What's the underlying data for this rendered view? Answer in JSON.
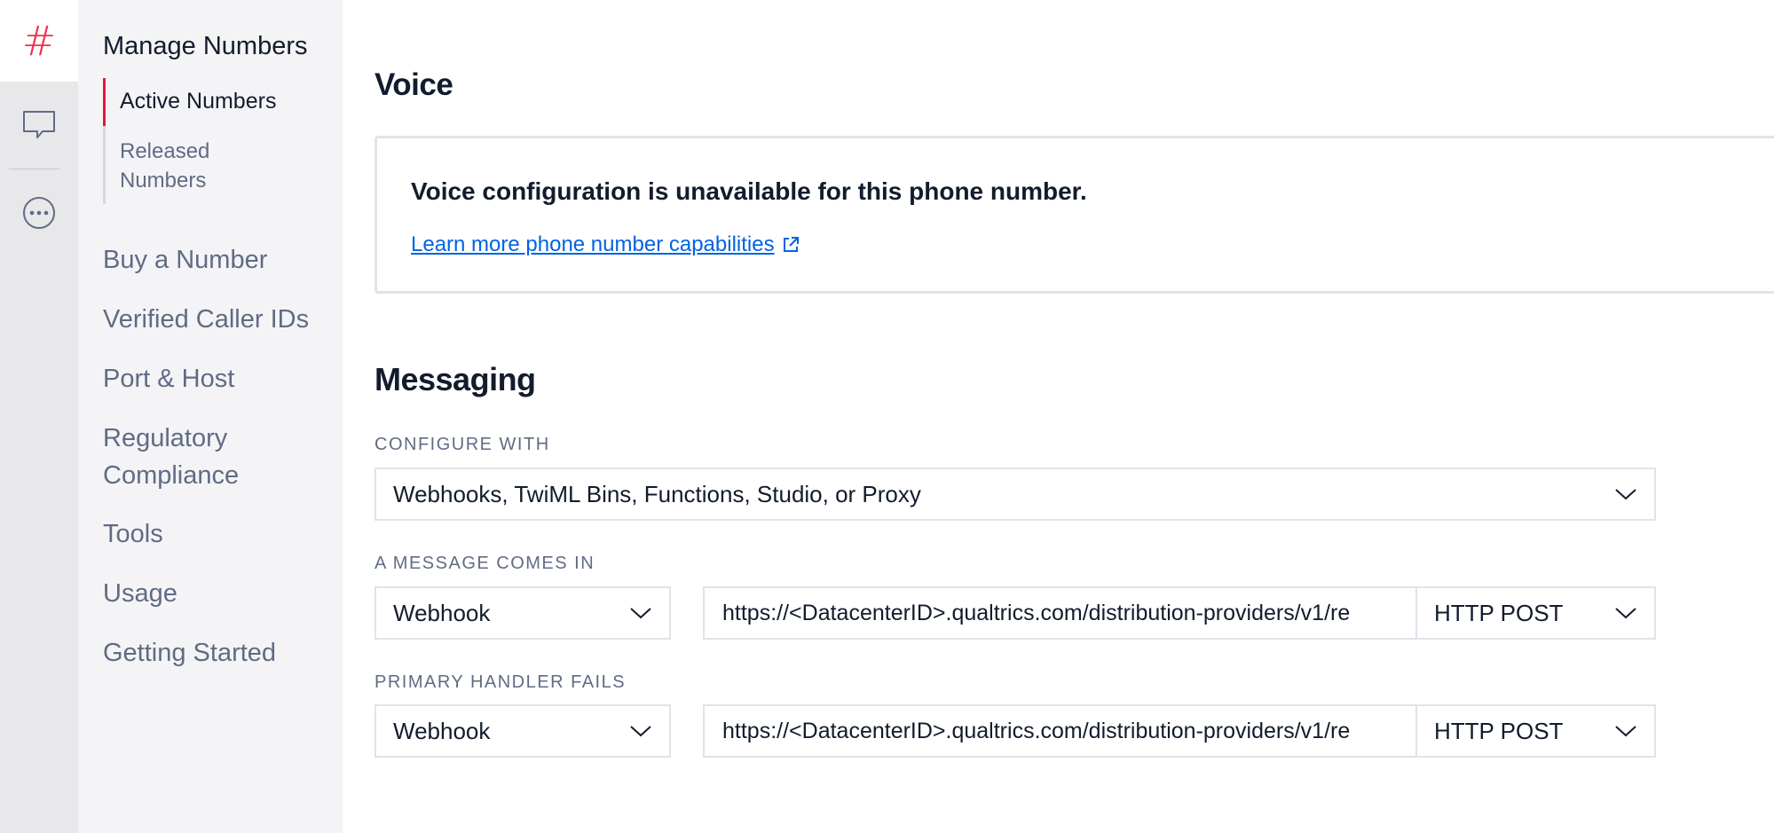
{
  "sidebar": {
    "title": "Manage Numbers",
    "sub_items": [
      {
        "label": "Active Numbers"
      },
      {
        "label": "Released Numbers"
      }
    ],
    "items": [
      {
        "label": "Buy a Number"
      },
      {
        "label": "Verified Caller IDs"
      },
      {
        "label": "Port & Host"
      },
      {
        "label": "Regulatory Compliance"
      },
      {
        "label": "Tools"
      },
      {
        "label": "Usage"
      },
      {
        "label": "Getting Started"
      }
    ]
  },
  "rail": {
    "icons": [
      "hash-icon",
      "chat-icon",
      "more-icon"
    ],
    "hash_glyph": "#",
    "accent": "#f22f46"
  },
  "voice": {
    "heading": "Voice",
    "message": "Voice configuration is unavailable for this phone number.",
    "link": "Learn more phone number capabilities"
  },
  "messaging": {
    "heading": "Messaging",
    "configure_label": "CONFIGURE WITH",
    "configure_value": "Webhooks, TwiML Bins, Functions, Studio, or Proxy",
    "incoming": {
      "label": "A MESSAGE COMES IN",
      "type": "Webhook",
      "url": "https://<DatacenterID>.qualtrics.com/distribution-providers/v1/re",
      "method": "HTTP POST"
    },
    "fallback": {
      "label": "PRIMARY HANDLER FAILS",
      "type": "Webhook",
      "url": "https://<DatacenterID>.qualtrics.com/distribution-providers/v1/re",
      "method": "HTTP POST"
    }
  },
  "colors": {
    "link": "#0263e0",
    "active_indicator": "#e31837",
    "text": "#121c2d",
    "muted": "#606b85"
  }
}
